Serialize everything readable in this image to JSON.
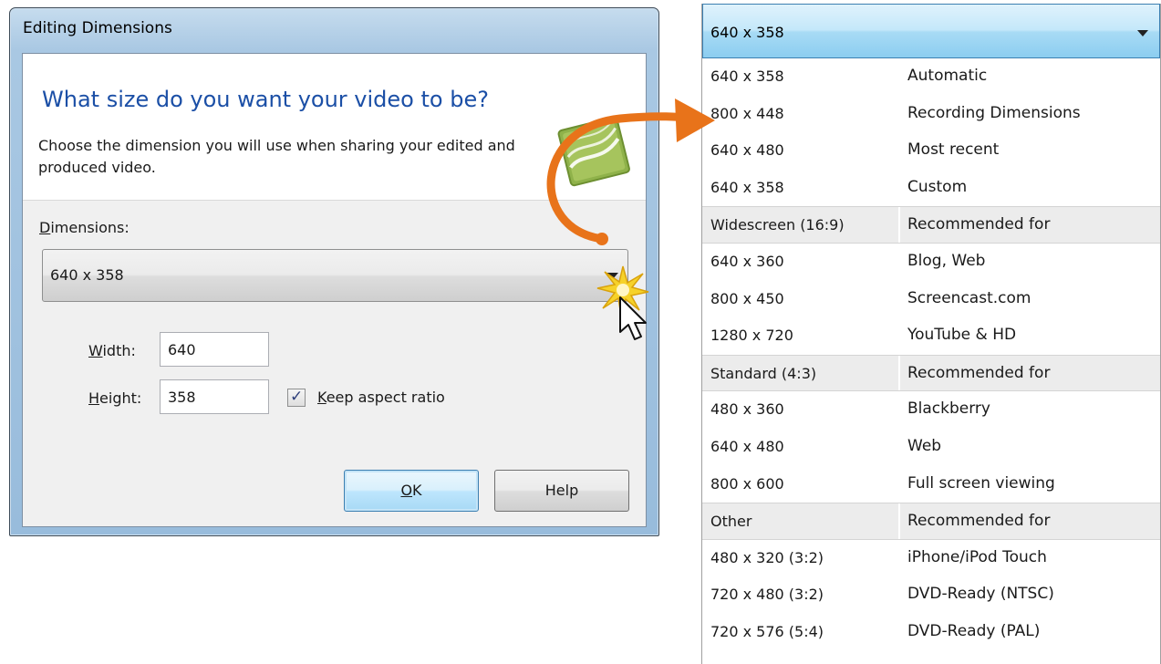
{
  "dialog": {
    "title": "Editing Dimensions",
    "heading": "What size do you want your video to be?",
    "description": "Choose the dimension you will use when sharing your edited and produced video.",
    "dimensions_label_accel": "D",
    "dimensions_label_rest": "imensions:",
    "dimensions_value": "640 x 358",
    "width_label_accel": "W",
    "width_label_rest": "idth:",
    "width_value": "640",
    "height_label_accel": "H",
    "height_label_rest": "eight:",
    "height_value": "358",
    "keep_aspect_checked": true,
    "keep_aspect_accel": "K",
    "keep_aspect_rest": "eep aspect ratio",
    "ok_accel": "O",
    "ok_rest": "K",
    "help_label": "Help"
  },
  "dropdown": {
    "selected": "640 x 358",
    "rows": [
      {
        "c1": "640 x 358",
        "c2": "Automatic",
        "group": false
      },
      {
        "c1": "800 x 448",
        "c2": "Recording Dimensions",
        "group": false
      },
      {
        "c1": "640 x 480",
        "c2": "Most recent",
        "group": false
      },
      {
        "c1": "640 x 358",
        "c2": "Custom",
        "group": false
      },
      {
        "c1": "Widescreen (16:9)",
        "c2": "Recommended for",
        "group": true
      },
      {
        "c1": "640 x 360",
        "c2": "Blog, Web",
        "group": false
      },
      {
        "c1": "800 x 450",
        "c2": "Screencast.com",
        "group": false
      },
      {
        "c1": "1280 x 720",
        "c2": "YouTube & HD",
        "group": false
      },
      {
        "c1": "Standard (4:3)",
        "c2": "Recommended for",
        "group": true
      },
      {
        "c1": "480 x 360",
        "c2": "Blackberry",
        "group": false
      },
      {
        "c1": "640 x 480",
        "c2": "Web",
        "group": false
      },
      {
        "c1": "800 x 600",
        "c2": "Full screen viewing",
        "group": false
      },
      {
        "c1": "Other",
        "c2": "Recommended for",
        "group": true
      },
      {
        "c1": "480 x 320 (3:2)",
        "c2": "iPhone/iPod Touch",
        "group": false
      },
      {
        "c1": "720 x 480 (3:2)",
        "c2": "DVD-Ready (NTSC)",
        "group": false
      },
      {
        "c1": "720 x 576 (5:4)",
        "c2": "DVD-Ready (PAL)",
        "group": false
      }
    ]
  },
  "colors": {
    "heading_blue": "#1b4fa6",
    "annotation_orange": "#e8731a",
    "title_bar_blue": "#a9c8e3"
  },
  "icons": {
    "header_graphic": "film-strip-icon",
    "cursor": "mouse-pointer-icon",
    "click_burst": "click-burst-icon",
    "arrow": "curved-arrow-annotation"
  }
}
